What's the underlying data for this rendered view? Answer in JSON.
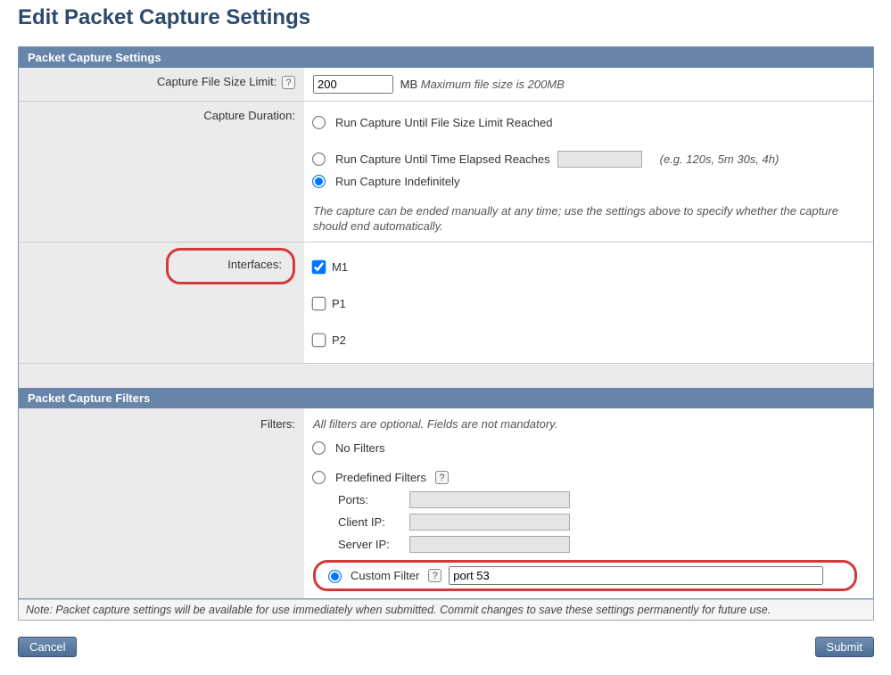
{
  "page": {
    "title": "Edit Packet Capture Settings"
  },
  "settings_header": "Packet Capture Settings",
  "filters_header": "Packet Capture Filters",
  "capture_file": {
    "label": "Capture File Size Limit:",
    "value": "200",
    "unit": "MB",
    "hint": "Maximum file size is 200MB"
  },
  "capture_duration": {
    "label": "Capture Duration:",
    "opt1": "Run Capture Until File Size Limit Reached",
    "opt2": "Run Capture Until Time Elapsed Reaches",
    "opt2_value": "",
    "opt2_hint": "(e.g. 120s, 5m 30s, 4h)",
    "opt3": "Run Capture Indefinitely",
    "selected": "opt3",
    "note": "The capture can be ended manually at any time; use the settings above to specify whether the capture should end automatically."
  },
  "interfaces": {
    "label": "Interfaces:",
    "items": [
      {
        "name": "M1",
        "checked": true
      },
      {
        "name": "P1",
        "checked": false
      },
      {
        "name": "P2",
        "checked": false
      }
    ]
  },
  "filters": {
    "label": "Filters:",
    "hint": "All filters are optional. Fields are not mandatory.",
    "opt_none": "No Filters",
    "opt_predef": "Predefined Filters",
    "predef": {
      "ports_label": "Ports:",
      "ports_value": "",
      "clientip_label": "Client IP:",
      "clientip_value": "",
      "serverip_label": "Server IP:",
      "serverip_value": ""
    },
    "opt_custom": "Custom Filter",
    "custom_value": "port 53",
    "selected": "custom"
  },
  "footer_note": "Note: Packet capture settings will be available for use immediately when submitted. Commit changes to save these settings permanently for future use.",
  "buttons": {
    "cancel": "Cancel",
    "submit": "Submit"
  }
}
